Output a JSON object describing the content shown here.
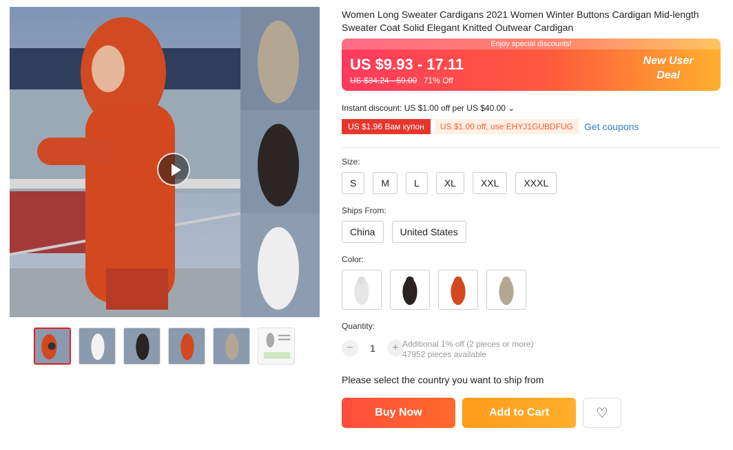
{
  "product": {
    "title": "Women Long Sweater Cardigans 2021 Women Winter Buttons Cardigan Mid-length Sweater Coat Solid Elegant Knitted Outwear Cardigan"
  },
  "price": {
    "banner_top": "Enjoy special discounts!",
    "range": "US $9.93 - 17.11",
    "original": "US $34.24 - 59.00",
    "discount": "71% Off",
    "deal_line1": "New User",
    "deal_line2": "Deal"
  },
  "instant_discount": "Instant discount: US $1.00 off per US $40.00 ⌄",
  "coupons": {
    "red": "US $1.96 Вам купон",
    "orange": "US $1.00 off, use EHYJ1GUBDFUG",
    "link": "Get coupons"
  },
  "size": {
    "label": "Size:",
    "options": [
      "S",
      "M",
      "L",
      "XL",
      "XXL",
      "XXXL"
    ]
  },
  "ships_from": {
    "label": "Ships From:",
    "options": [
      "China",
      "United States"
    ]
  },
  "color": {
    "label": "Color:",
    "options": [
      "white-icon",
      "black-icon",
      "red-icon",
      "khaki-icon"
    ]
  },
  "quantity": {
    "label": "Quantity:",
    "minus": "−",
    "value": "1",
    "plus": "+",
    "info_line1": "Additional 1% off (2 pieces or more)",
    "info_line2": "47952 pieces available"
  },
  "ship_message": "Please select the country you want to ship from",
  "actions": {
    "buy_now": "Buy Now",
    "add_to_cart": "Add to Cart",
    "wishlist": "♡"
  },
  "colors": {
    "red": "#e6362c",
    "orange_text": "#ff5a2a",
    "link": "#2d7fcf"
  }
}
